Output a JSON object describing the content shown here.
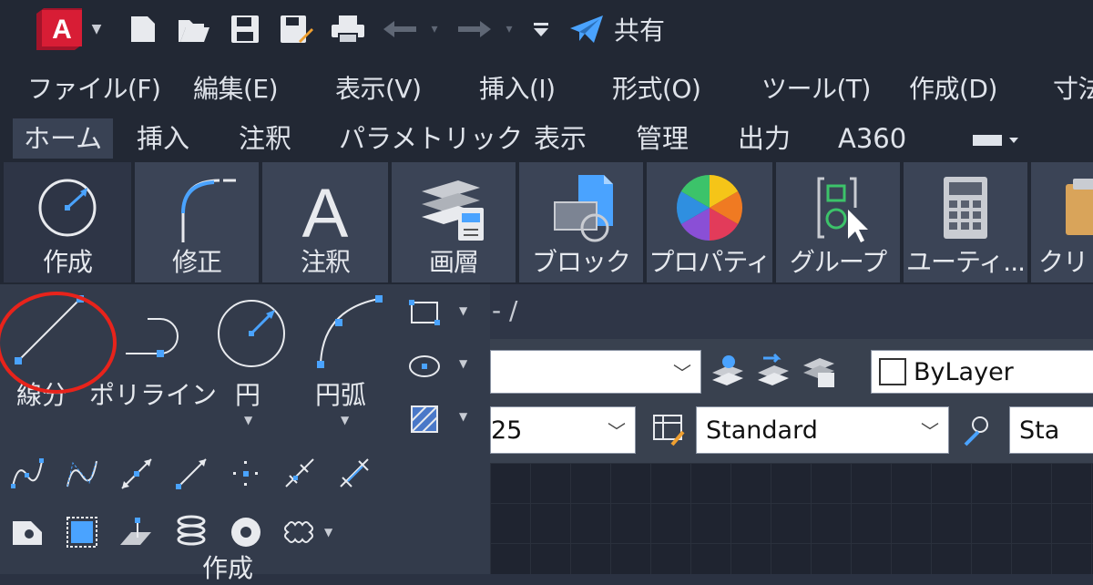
{
  "quick_access": {
    "share_label": "共有",
    "app_letter": "A"
  },
  "menu": [
    "ファイル(F)",
    "編集(E)",
    "表示(V)",
    "挿入(I)",
    "形式(O)",
    "ツール(T)",
    "作成(D)",
    "寸法"
  ],
  "tabs": [
    "ホーム",
    "挿入",
    "注釈",
    "パラメトリック",
    "表示",
    "管理",
    "出力",
    "A360"
  ],
  "panels": [
    "作成",
    "修正",
    "注釈",
    "画層",
    "ブロック",
    "プロパティ",
    "グループ",
    "ユーティ...",
    "クリ"
  ],
  "panel_icon_text": {
    "annotation": "A"
  },
  "draw_tools": {
    "line": "線分",
    "polyline": "ポリライン",
    "circle": "円",
    "arc": "円弧"
  },
  "dropdown_footer": "作成",
  "properties": {
    "layer_value": "ByLayer",
    "text_style": "Standard",
    "dim_value": "25",
    "table_style": "Sta"
  },
  "colors": {
    "accent": "#4aa3ff",
    "highlight": "#e8231b",
    "logo": "#d81d35"
  }
}
